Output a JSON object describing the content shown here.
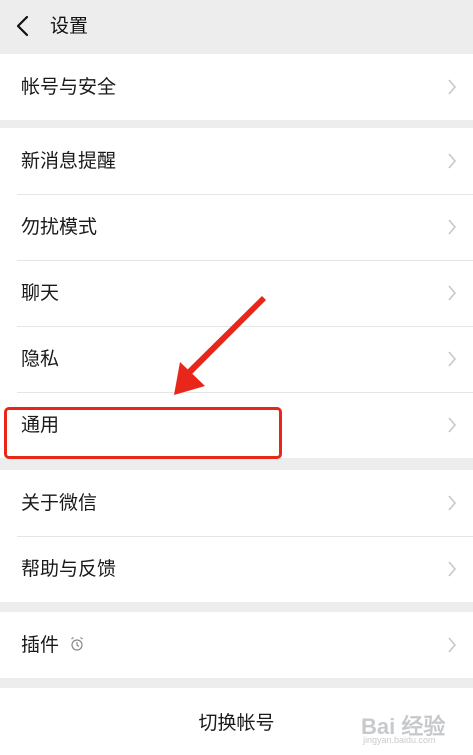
{
  "header": {
    "title": "设置"
  },
  "groups": [
    {
      "items": [
        {
          "label": "帐号与安全"
        }
      ]
    },
    {
      "items": [
        {
          "label": "新消息提醒"
        },
        {
          "label": "勿扰模式"
        },
        {
          "label": "聊天"
        },
        {
          "label": "隐私"
        },
        {
          "label": "通用"
        }
      ]
    },
    {
      "items": [
        {
          "label": "关于微信"
        },
        {
          "label": "帮助与反馈"
        }
      ]
    },
    {
      "items": [
        {
          "label": "插件"
        }
      ]
    }
  ],
  "switch_account": {
    "label": "切换帐号"
  },
  "watermark": {
    "brand": "Bai 经验",
    "url": "jingyan.baidu.com"
  },
  "colors": {
    "highlight": "#e8261a",
    "background": "#ededed",
    "row": "#ffffff"
  },
  "icons": {
    "back": "chevron-left-icon",
    "row": "chevron-right-icon",
    "plugin": "alarm-clock-icon"
  }
}
